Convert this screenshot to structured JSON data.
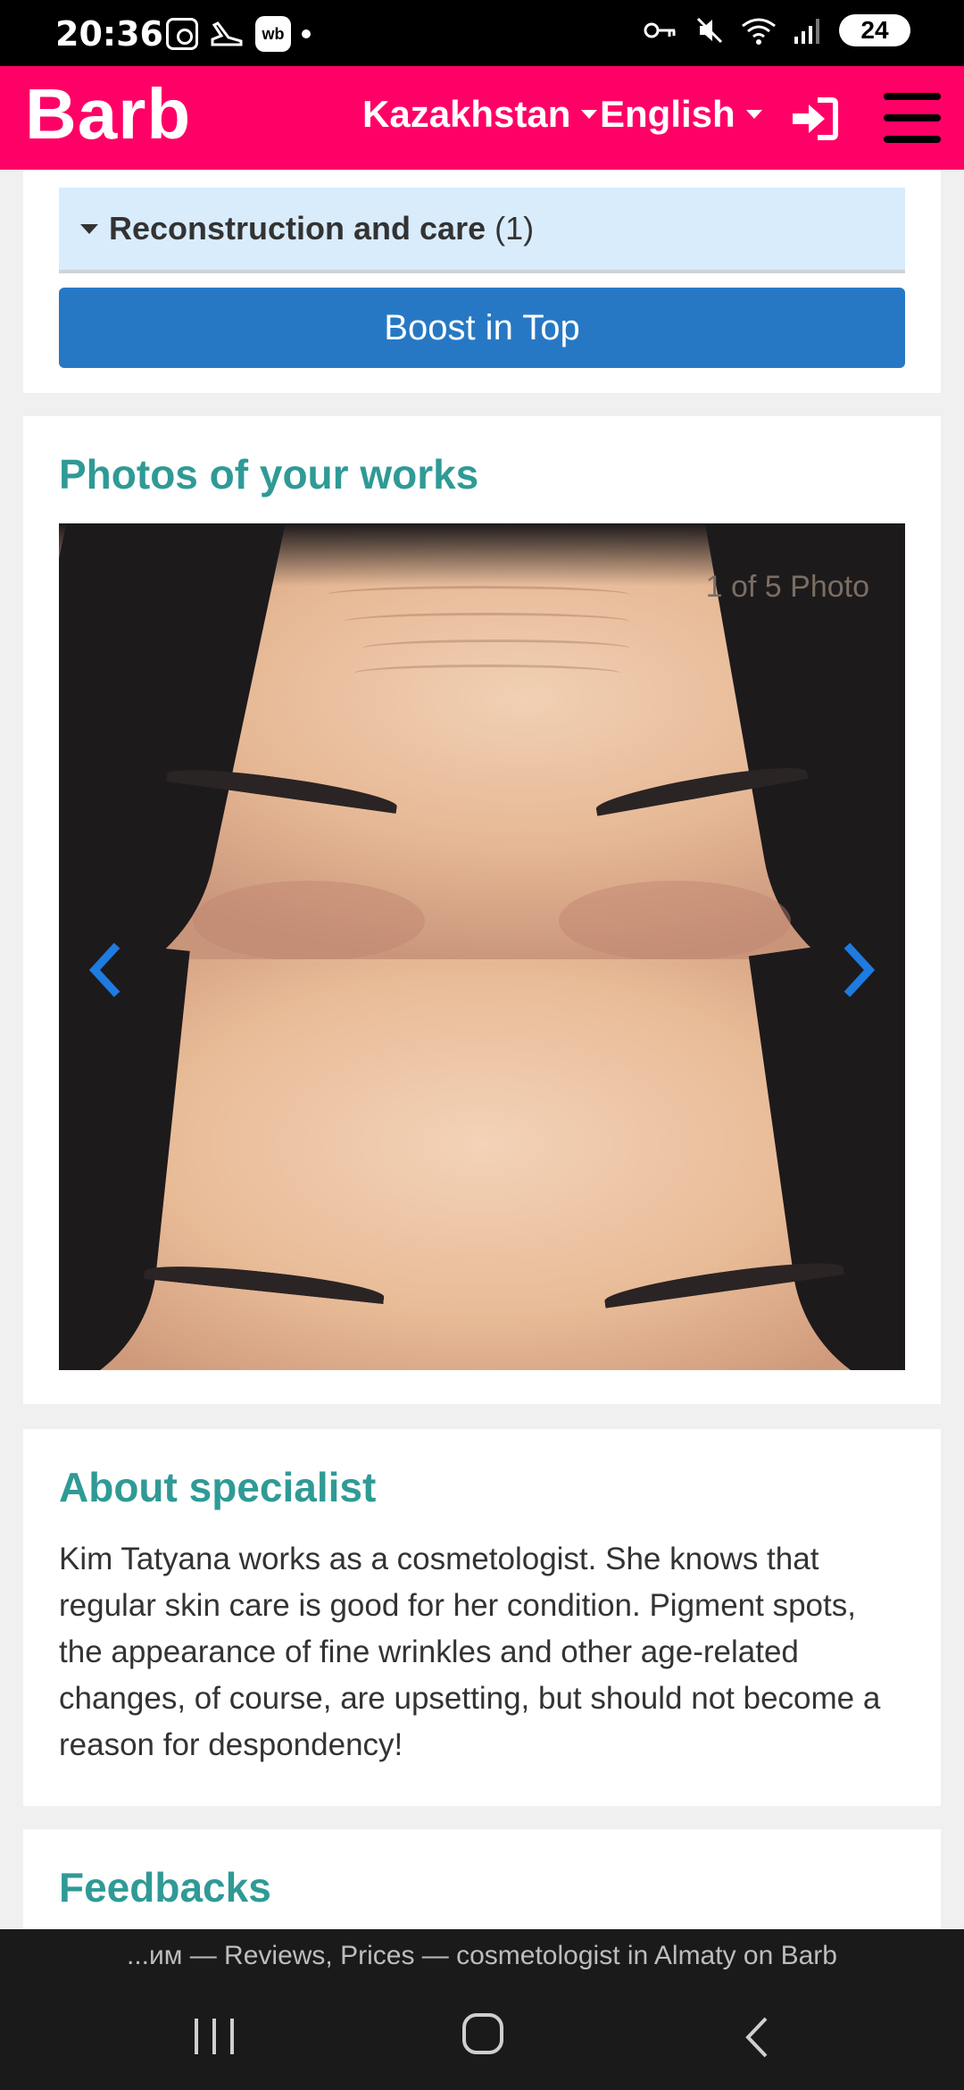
{
  "status_bar": {
    "time": "20:36",
    "wb_label": "wb",
    "battery": "24"
  },
  "header": {
    "logo": "Barb",
    "country": "Kazakhstan",
    "language": "English",
    "brand_color": "#ff0066"
  },
  "services": {
    "category_label": "Reconstruction and care",
    "category_count": "(1)",
    "boost_button": "Boost in Top"
  },
  "photos": {
    "title": "Photos of your works",
    "counter": "1 of 5 Photo"
  },
  "about": {
    "title": "About specialist",
    "text": "Kim Tatyana works as a cosmetologist. She knows that regular skin care is good for her condition. Pigment spots, the appearance of fine wrinkles and other age-related changes, of course, are upsetting, but should not become a reason for despondency!"
  },
  "feedbacks": {
    "title": "Feedbacks"
  },
  "browser": {
    "page_title": "...им — Reviews, Prices — cosmetologist in Almaty on Barb"
  },
  "colors": {
    "accent_teal": "#2f9a96",
    "button_blue": "#2778c4",
    "accordion_bg": "#d9ecfc"
  }
}
